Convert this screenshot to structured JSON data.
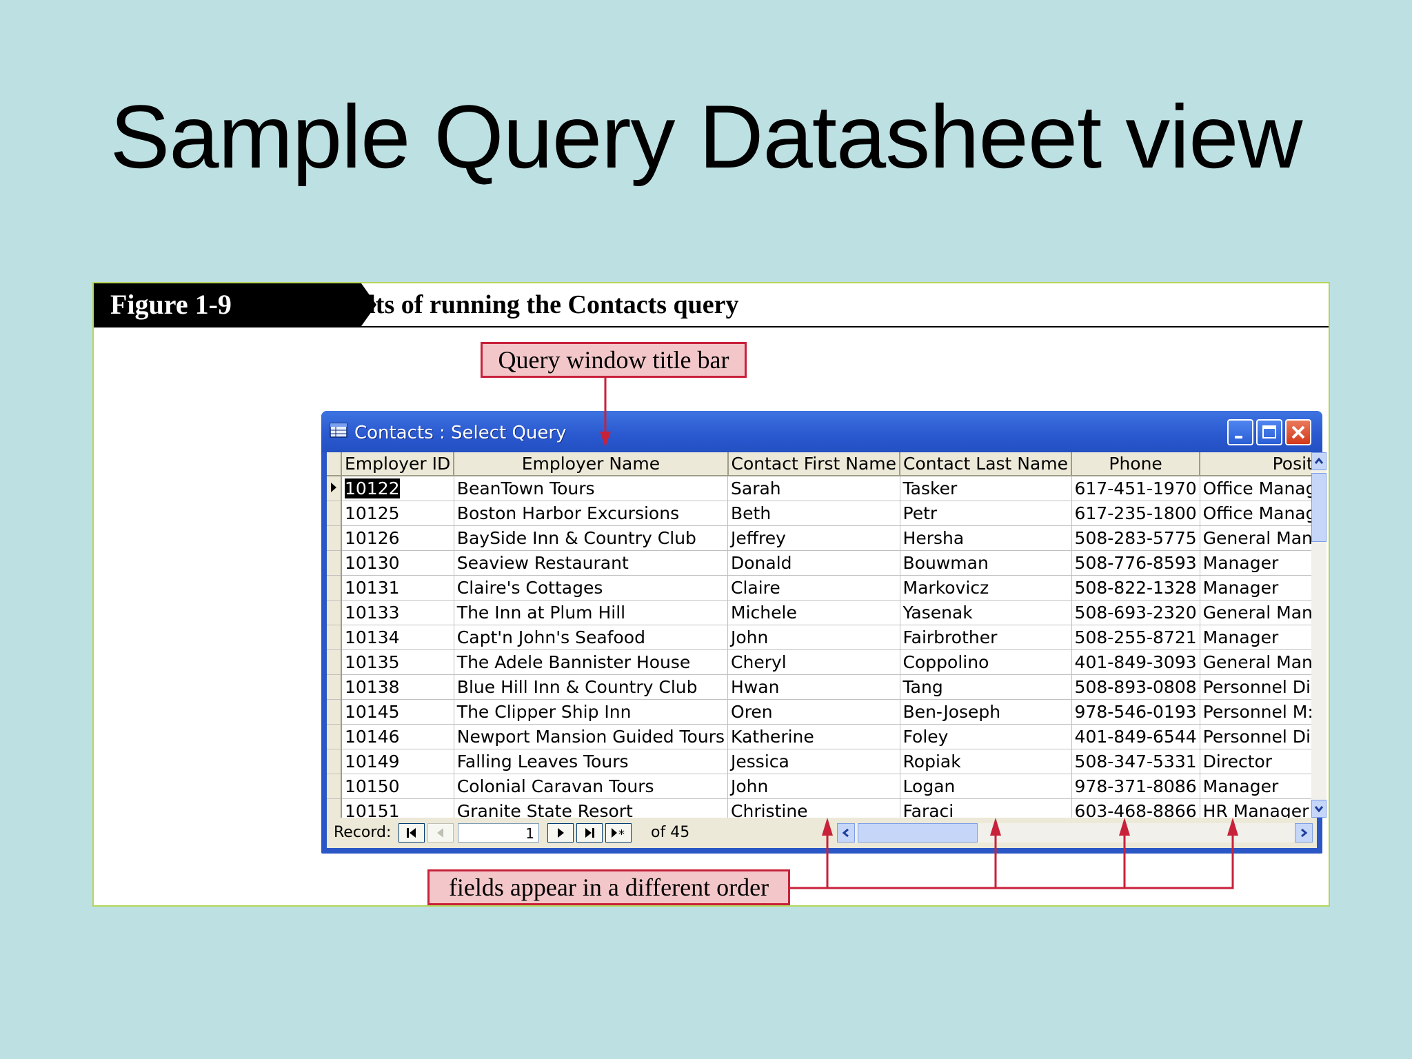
{
  "slide": {
    "title": "Sample Query Datasheet view"
  },
  "figure": {
    "tag": "Figure 1-9",
    "caption": "Results of running the Contacts query",
    "callouts": {
      "title_bar": "Query window title bar",
      "field_order": "fields appear in a different order"
    },
    "annotation_color": "#c8213a"
  },
  "window": {
    "title": "Contacts : Select Query",
    "title_icon": "query-datasheet-icon",
    "buttons": [
      "minimize-icon",
      "maximize-icon",
      "close-icon"
    ],
    "columns": [
      "Employer ID",
      "Employer Name",
      "Contact First Name",
      "Contact Last Name",
      "Phone",
      "Positi"
    ],
    "rows": [
      [
        "10122",
        "BeanTown Tours",
        "Sarah",
        "Tasker",
        "617-451-1970",
        "Office Manag"
      ],
      [
        "10125",
        "Boston Harbor Excursions",
        "Beth",
        "Petr",
        "617-235-1800",
        "Office Manag"
      ],
      [
        "10126",
        "BaySide Inn & Country Club",
        "Jeffrey",
        "Hersha",
        "508-283-5775",
        "General Man:"
      ],
      [
        "10130",
        "Seaview Restaurant",
        "Donald",
        "Bouwman",
        "508-776-8593",
        "Manager"
      ],
      [
        "10131",
        "Claire's Cottages",
        "Claire",
        "Markovicz",
        "508-822-1328",
        "Manager"
      ],
      [
        "10133",
        "The Inn at Plum Hill",
        "Michele",
        "Yasenak",
        "508-693-2320",
        "General Man:"
      ],
      [
        "10134",
        "Capt'n John's Seafood",
        "John",
        "Fairbrother",
        "508-255-8721",
        "Manager"
      ],
      [
        "10135",
        "The Adele Bannister House",
        "Cheryl",
        "Coppolino",
        "401-849-3093",
        "General Man:"
      ],
      [
        "10138",
        "Blue Hill Inn & Country Club",
        "Hwan",
        "Tang",
        "508-893-0808",
        "Personnel Di"
      ],
      [
        "10145",
        "The Clipper Ship Inn",
        "Oren",
        "Ben-Joseph",
        "978-546-0193",
        "Personnel M:"
      ],
      [
        "10146",
        "Newport Mansion Guided Tours",
        "Katherine",
        "Foley",
        "401-849-6544",
        "Personnel Di"
      ],
      [
        "10149",
        "Falling Leaves Tours",
        "Jessica",
        "Ropiak",
        "508-347-5331",
        "Director"
      ],
      [
        "10150",
        "Colonial Caravan Tours",
        "John",
        "Logan",
        "978-371-8086",
        "Manager"
      ],
      [
        "10151",
        "Granite State Resort",
        "Christine",
        "Faraci",
        "603-468-8866",
        "HR Manager"
      ]
    ],
    "navigation": {
      "label": "Record:",
      "current": "1",
      "of_text": "of 45",
      "buttons": [
        "first-record-icon",
        "previous-record-icon",
        "next-record-icon",
        "last-record-icon",
        "new-record-icon"
      ]
    }
  }
}
